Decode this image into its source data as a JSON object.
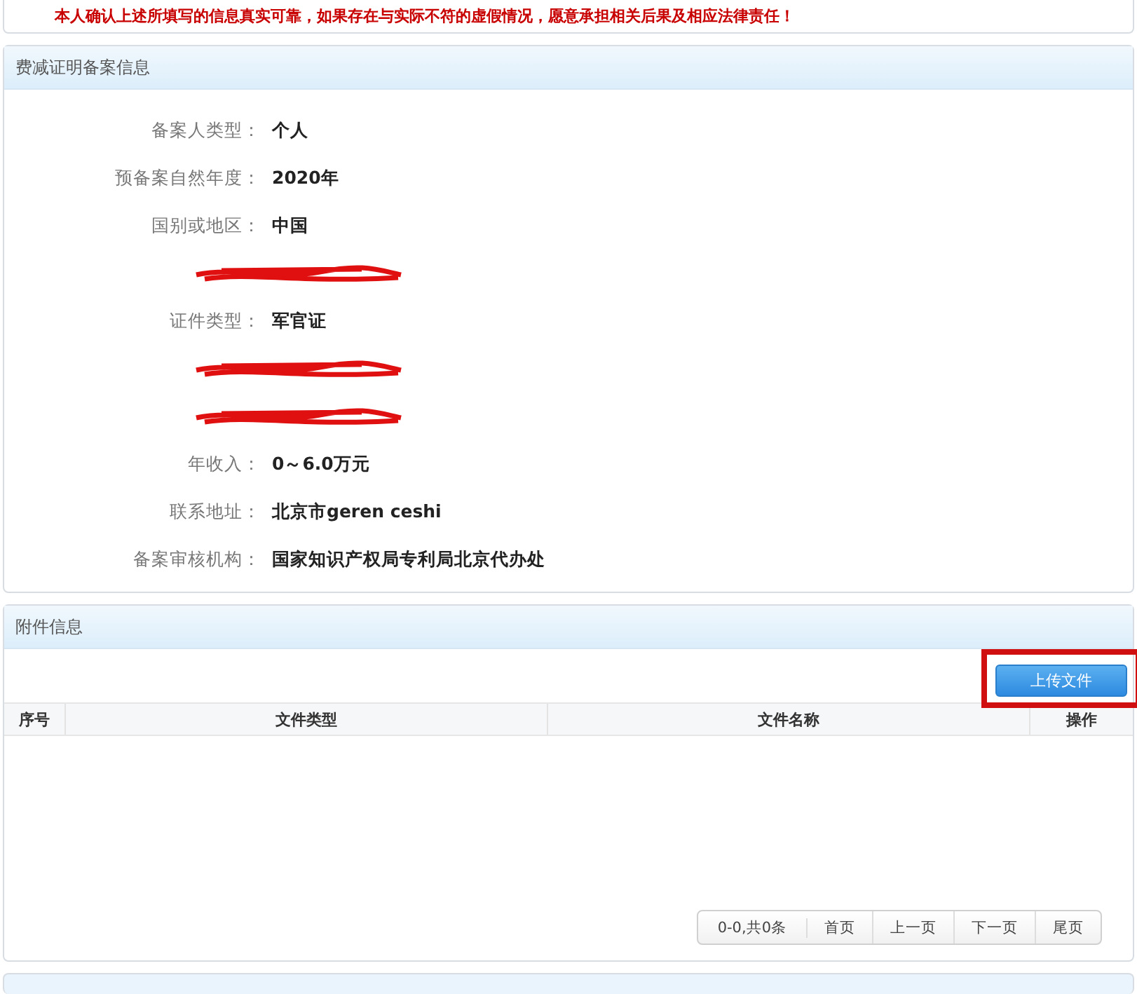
{
  "notice": "本人确认上述所填写的信息真实可靠，如果存在与实际不符的虚假情况，愿意承担相关后果及相应法律责任！",
  "record_panel": {
    "title": "费减证明备案信息",
    "fields": [
      {
        "kind": "field",
        "label": "备案人类型：",
        "value": "个人"
      },
      {
        "kind": "field",
        "label": "预备案自然年度：",
        "value": "2020年"
      },
      {
        "kind": "field",
        "label": "国别或地区：",
        "value": "中国"
      },
      {
        "kind": "redacted"
      },
      {
        "kind": "field",
        "label": "证件类型：",
        "value": "军官证"
      },
      {
        "kind": "redacted"
      },
      {
        "kind": "redacted"
      },
      {
        "kind": "field",
        "label": "年收入：",
        "value": "0～6.0万元"
      },
      {
        "kind": "field",
        "label": "联系地址：",
        "value": "北京市geren ceshi"
      },
      {
        "kind": "field",
        "label": "备案审核机构：",
        "value": "国家知识产权局专利局北京代办处"
      }
    ]
  },
  "attachment_panel": {
    "title": "附件信息",
    "upload_button": "上传文件",
    "highlighted": true,
    "table": {
      "columns": [
        "序号",
        "文件类型",
        "文件名称",
        "操作"
      ]
    },
    "pagination": {
      "summary": "0-0,共0条",
      "buttons": [
        "首页",
        "上一页",
        "下一页",
        "尾页"
      ]
    }
  }
}
